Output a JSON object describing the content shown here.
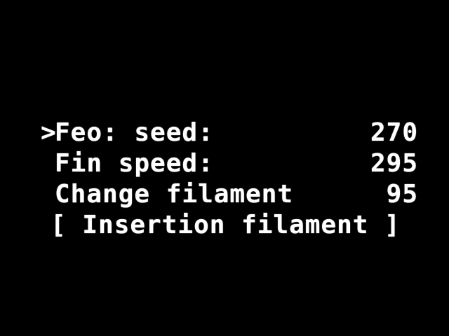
{
  "menu": {
    "cursor": ">",
    "items": [
      {
        "label": "Feo: seed:",
        "value": "270"
      },
      {
        "label": "Fin speed:",
        "value": "295"
      },
      {
        "label": "Change filament",
        "value": "95"
      },
      {
        "label": "[ Insertion filament ]",
        "value": ""
      }
    ]
  },
  "colors": {
    "background": "#000000",
    "foreground": "#ffffff"
  }
}
